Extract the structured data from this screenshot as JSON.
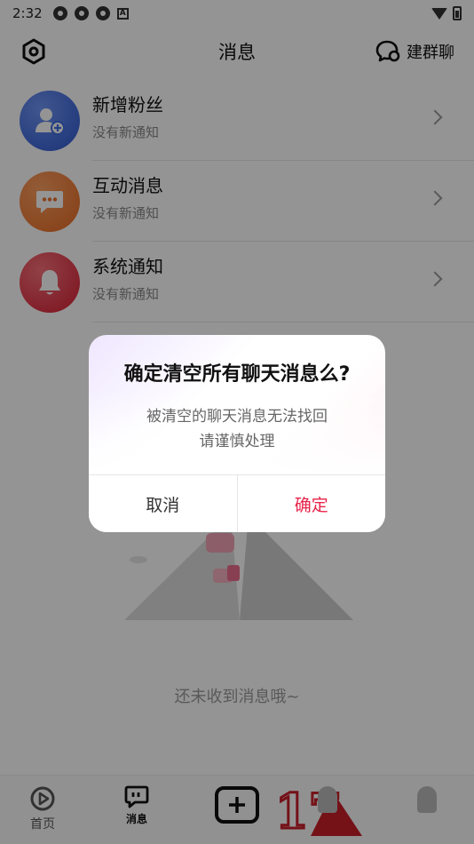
{
  "status_bar": {
    "time": "2:32",
    "letter_icon": "A"
  },
  "header": {
    "title": "消息",
    "group_chat_label": "建群聊"
  },
  "messages": [
    {
      "title": "新增粉丝",
      "subtitle": "没有新通知",
      "icon": "add-follower-icon",
      "color": "#3d6de0"
    },
    {
      "title": "互动消息",
      "subtitle": "没有新通知",
      "icon": "chat-bubble-icon",
      "color": "#f0813a"
    },
    {
      "title": "系统通知",
      "subtitle": "没有新通知",
      "icon": "bell-icon",
      "color": "#e83a4a"
    }
  ],
  "empty_state": {
    "text": "还未收到消息哦~"
  },
  "bottom_nav": {
    "home_label": "首页",
    "msg_label": "消息",
    "badge_number": "17"
  },
  "dialog": {
    "title": "确定清空所有聊天消息么?",
    "message_line1": "被清空的聊天消息无法找回",
    "message_line2": "请谨慎处理",
    "cancel_label": "取消",
    "confirm_label": "确定"
  },
  "colors": {
    "accent": "#e8234a"
  }
}
